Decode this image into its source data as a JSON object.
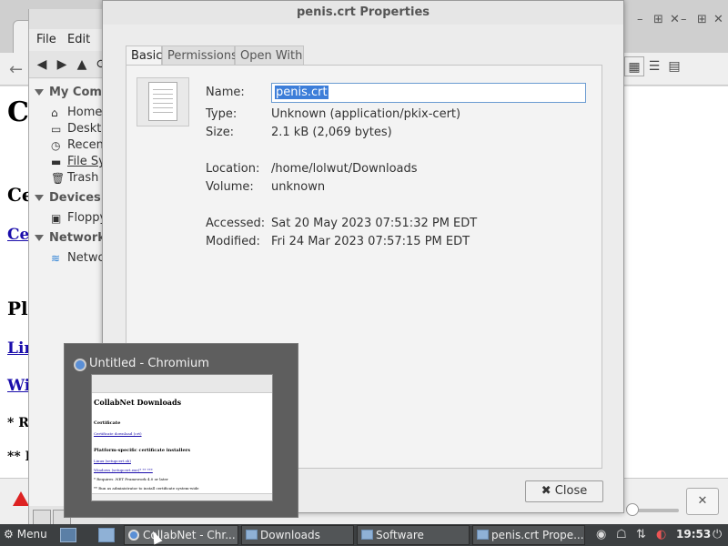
{
  "dialog": {
    "title": "penis.crt Properties",
    "tabs": [
      {
        "label": "Basic"
      },
      {
        "label": "Permissions"
      },
      {
        "label": "Open With"
      }
    ],
    "fields": {
      "name_label": "Name:",
      "name_value": "penis.crt",
      "type_label": "Type:",
      "type_value": "Unknown (application/pkix-cert)",
      "size_label": "Size:",
      "size_value": "2.1 kB (2,069 bytes)",
      "location_label": "Location:",
      "location_value": "/home/lolwut/Downloads",
      "volume_label": "Volume:",
      "volume_value": "unknown",
      "accessed_label": "Accessed:",
      "accessed_value": "Sat 20 May 2023 07:51:32 PM EDT",
      "modified_label": "Modified:",
      "modified_value": "Fri 24 Mar 2023 07:57:15 PM EDT"
    },
    "close_label": "Close"
  },
  "file_manager": {
    "menu": [
      "File",
      "Edit"
    ],
    "sections": [
      {
        "header": "My Comp",
        "items": [
          {
            "label": "Home",
            "icon": "home-icon"
          },
          {
            "label": "Deskto",
            "icon": "desktop-icon"
          },
          {
            "label": "Recent",
            "icon": "clock-icon"
          },
          {
            "label": "File Sys",
            "icon": "drive-icon"
          },
          {
            "label": "Trash",
            "icon": "trash-icon"
          }
        ]
      },
      {
        "header": "Devices",
        "items": [
          {
            "label": "Floppy",
            "icon": "floppy-icon"
          }
        ]
      },
      {
        "header": "Network",
        "items": [
          {
            "label": "Networ",
            "icon": "wifi-icon"
          }
        ]
      }
    ]
  },
  "background_page": {
    "h1": "C",
    "h2": "Ce",
    "link1": "Ce",
    "h2b": "Pl",
    "link2": "Lir",
    "link3": "Wi",
    "note1": "* R",
    "note2": "** I"
  },
  "preview": {
    "title": "Untitled - Chromium",
    "thumb": {
      "h1": "CollabNet Downloads",
      "h2": "Certificate",
      "link1": "Certificate download (crt)",
      "h3": "Platform-specific certificate installers",
      "link2": "Linux (setupcert.sh)",
      "link3": "Windows (setupcert.exe)* ** ***",
      "note1": "* Requires .NET Framework 4.0 or later",
      "note2": "** Run as administrator to install certificate system-wide"
    }
  },
  "taskbar": {
    "menu_label": "Menu",
    "tasks": [
      {
        "label": "CollabNet - Chr...",
        "kind": "chrome"
      },
      {
        "label": "Downloads",
        "kind": "folder"
      },
      {
        "label": "Software",
        "kind": "window"
      },
      {
        "label": "penis.crt Prope...",
        "kind": "folder"
      }
    ],
    "clock": "19:53"
  },
  "colors": {
    "selection": "#3d7ed9",
    "taskbar": "#3c3f41",
    "link": "#1a0dab"
  }
}
